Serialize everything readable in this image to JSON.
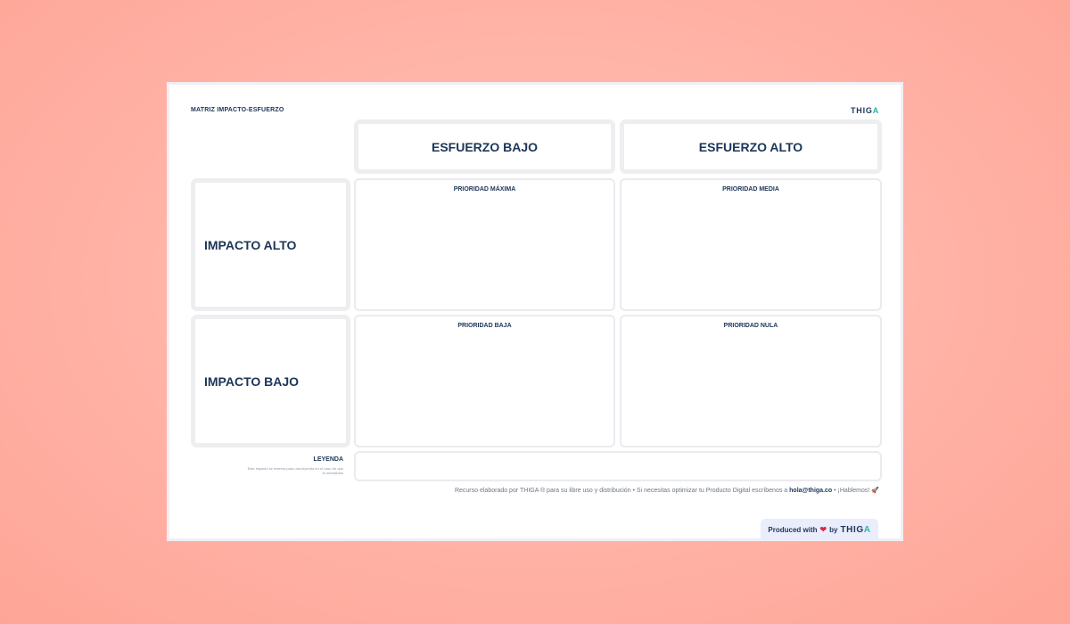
{
  "document": {
    "title": "MATRIZ IMPACTO-ESFUERZO"
  },
  "brand": {
    "name_main": "THIG",
    "name_accent": "A"
  },
  "matrix": {
    "columns": [
      "ESFUERZO BAJO",
      "ESFUERZO ALTO"
    ],
    "rows": [
      "IMPACTO ALTO",
      "IMPACTO BAJO"
    ],
    "quadrants": {
      "top_left": "PRIORIDAD MÁXIMA",
      "top_right": "PRIORIDAD MEDIA",
      "bottom_left": "PRIORIDAD BAJA",
      "bottom_right": "PRIORIDAD NULA"
    }
  },
  "legend": {
    "title": "LEYENDA",
    "note": "Este espacio se reserva para una leyenda en el caso de que la necesitase"
  },
  "footer": {
    "text_before": "Recurso elaborado por THIGA ® para su libre uso y distribución  •  Si necesitas optimizar tu Producto Digital escríbenos a ",
    "email": "hola@thiga.co",
    "text_after": "  •  ¡Hablemos! 🚀"
  },
  "produced_badge": {
    "prefix": "Produced with",
    "heart": "❤",
    "by": "by",
    "brand_main": "THIG",
    "brand_accent": "A"
  },
  "colors": {
    "background": "#ffb2a5",
    "text_primary": "#1c3558",
    "brand_accent": "#27b5a3",
    "cell_border": "#ebebef",
    "badge_bg": "#eaedfb"
  }
}
